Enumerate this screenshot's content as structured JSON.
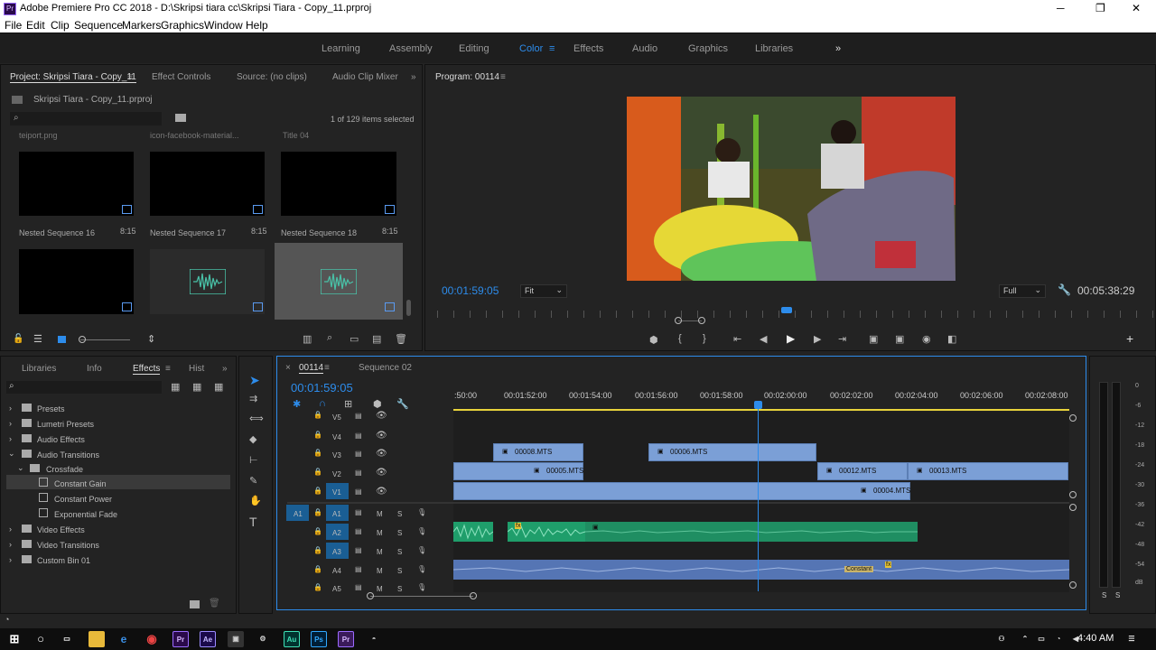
{
  "titlebar": {
    "title": "Adobe Premiere Pro CC 2018 - D:\\Skripsi tiara cc\\Skripsi Tiara - Copy_11.prproj",
    "minimize": "─",
    "maximize": "❐",
    "close": "✕"
  },
  "menu": [
    "File",
    "Edit",
    "Clip",
    "Sequence",
    "Markers",
    "Graphics",
    "Window",
    "Help"
  ],
  "workspaces": [
    "Learning",
    "Assembly",
    "Editing",
    "Color",
    "Effects",
    "Audio",
    "Graphics",
    "Libraries"
  ],
  "workspace_more": "»",
  "project": {
    "tabs": [
      "Project: Skripsi Tiara - Copy_11",
      "Effect Controls",
      "Source: (no clips)",
      "Audio Clip Mixer"
    ],
    "file": "Skripsi Tiara - Copy_11.prproj",
    "selected": "1 of 129 items selected",
    "items": [
      {
        "label": "Nested Sequence 16",
        "dur": "8:15"
      },
      {
        "label": "Nested Sequence 17",
        "dur": "8:15"
      },
      {
        "label": "Nested Sequence 18",
        "dur": "8:15"
      }
    ],
    "top_labels": [
      "teiport.png",
      "icon-facebook-material...",
      "Title 04"
    ]
  },
  "program": {
    "title": "Program: 00114",
    "timecode": "00:01:59:05",
    "fit": "Fit",
    "quality": "Full",
    "duration": "00:05:38:29"
  },
  "effects": {
    "tabs": [
      "Libraries",
      "Info",
      "Effects",
      "Hist"
    ],
    "tree": [
      {
        "label": "Presets",
        "indent": 0
      },
      {
        "label": "Lumetri Presets",
        "indent": 0
      },
      {
        "label": "Audio Effects",
        "indent": 0
      },
      {
        "label": "Audio Transitions",
        "indent": 0
      },
      {
        "label": "Crossfade",
        "indent": 1
      },
      {
        "label": "Constant Gain",
        "indent": 2
      },
      {
        "label": "Constant Power",
        "indent": 2
      },
      {
        "label": "Exponential Fade",
        "indent": 2
      },
      {
        "label": "Video Effects",
        "indent": 0
      },
      {
        "label": "Video Transitions",
        "indent": 0
      },
      {
        "label": "Custom Bin 01",
        "indent": 0
      }
    ]
  },
  "timeline": {
    "tabs": [
      "00114",
      "Sequence 02"
    ],
    "timecode": "00:01:59:05",
    "ticks": [
      ":50:00",
      "00:01:52:00",
      "00:01:54:00",
      "00:01:56:00",
      "00:01:58:00",
      "00:02:00:00",
      "00:02:02:00",
      "00:02:04:00",
      "00:02:06:00",
      "00:02:08:00"
    ],
    "video_tracks": [
      "V5",
      "V4",
      "V3",
      "V2",
      "V1"
    ],
    "audio_tracks": [
      "A1",
      "A2",
      "A3",
      "A4",
      "A5"
    ],
    "source_patch": "A1",
    "clips": [
      "00008.MTS",
      "00006.MTS",
      "00005.MTS",
      "00012.MTS",
      "00013.MTS",
      "00004.MTS"
    ],
    "transition_label": "Constant",
    "fx": "fx",
    "m": "M",
    "s": "S"
  },
  "meter": {
    "scale": [
      "0",
      "-6",
      "-12",
      "-18",
      "-24",
      "-30",
      "-36",
      "-42",
      "-48",
      "-54",
      "dB"
    ],
    "solo": [
      "S",
      "S"
    ]
  },
  "taskbar": {
    "time": "4:40 AM"
  }
}
